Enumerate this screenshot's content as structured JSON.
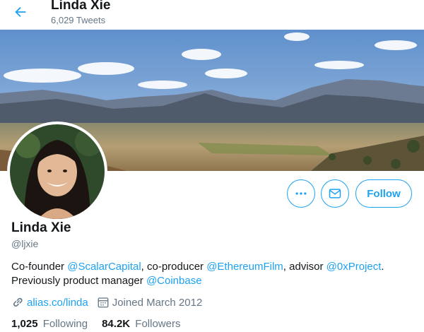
{
  "header": {
    "name": "Linda Xie",
    "tweet_count": "6,029 Tweets",
    "back_icon": "arrow-left-icon"
  },
  "colors": {
    "accent": "#1da1f2",
    "text": "#14171a",
    "muted": "#657786"
  },
  "profile": {
    "name": "Linda Xie",
    "handle": "@ljxie",
    "bio": {
      "p1": "Co-founder ",
      "l1": "@ScalarCapital",
      "p2": ", co-producer ",
      "l2": "@EthereumFilm",
      "p3": ", advisor ",
      "l3": "@0xProject",
      "p4": ". Previously product manager ",
      "l4": "@Coinbase"
    },
    "website": "alias.co/linda",
    "joined": "Joined March 2012"
  },
  "actions": {
    "more_icon": "more-icon",
    "message_icon": "envelope-icon",
    "follow_label": "Follow"
  },
  "stats": {
    "following_count": "1,025",
    "following_label": "Following",
    "followers_count": "84.2K",
    "followers_label": "Followers"
  }
}
